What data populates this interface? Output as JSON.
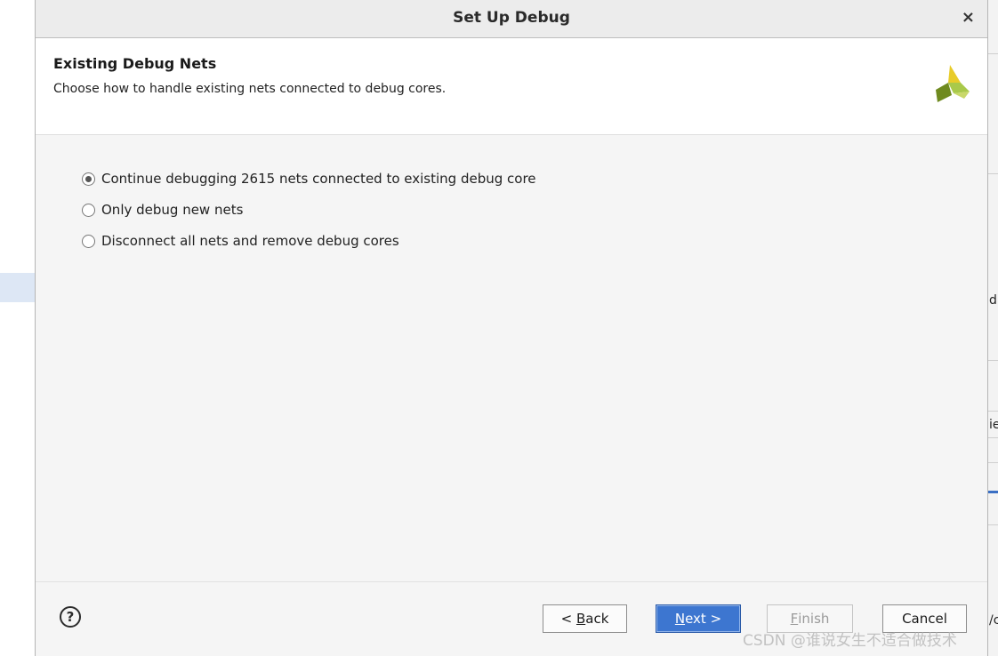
{
  "dialog": {
    "title": "Set Up Debug",
    "close_glyph": "×"
  },
  "header": {
    "title": "Existing Debug Nets",
    "subtitle": "Choose how to handle existing nets connected to debug cores.",
    "logo_icon": "xilinx-logo-icon"
  },
  "options": [
    {
      "label": "Continue debugging 2615 nets connected to existing debug core",
      "selected": true
    },
    {
      "label": "Only debug new nets",
      "selected": false
    },
    {
      "label": "Disconnect all nets and remove debug cores",
      "selected": false
    }
  ],
  "footer": {
    "help_glyph": "?",
    "back": {
      "prefix": "< ",
      "mnemonic": "B",
      "rest": "ack"
    },
    "next": {
      "mnemonic": "N",
      "rest": "ext >"
    },
    "finish": {
      "mnemonic": "F",
      "rest": "inish"
    },
    "cancel": "Cancel"
  },
  "background": {
    "frag1": "d",
    "frag2": "ie",
    "frag3": "/c"
  },
  "watermark": "CSDN @谁说女生不适合做技术"
}
